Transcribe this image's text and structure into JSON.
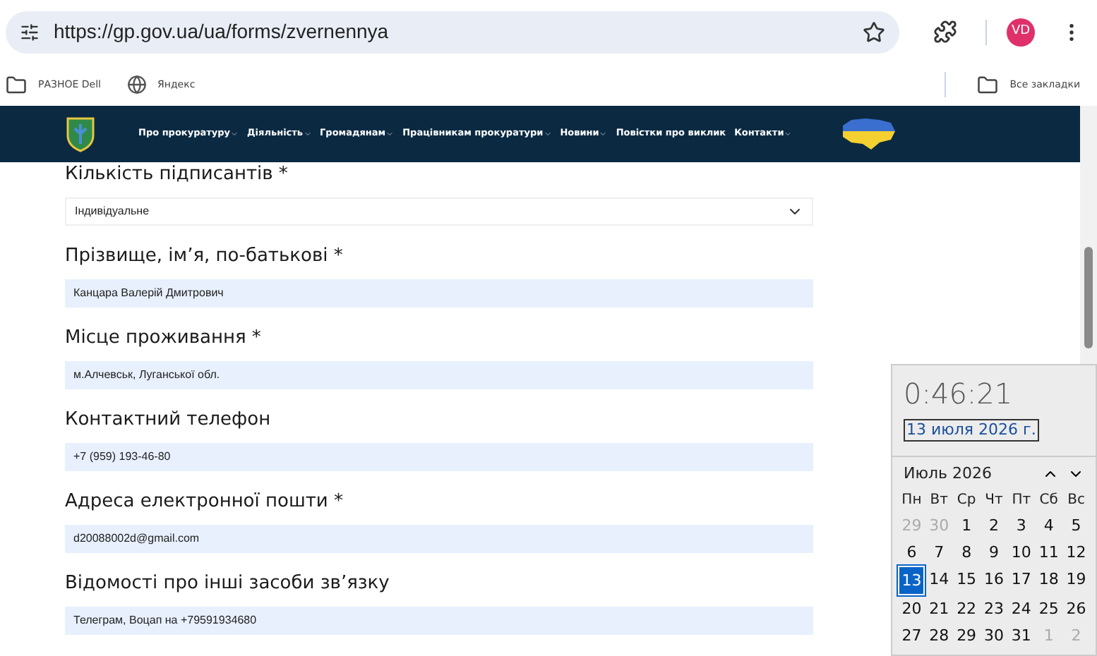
{
  "browser": {
    "url": "https://gp.gov.ua/ua/forms/zvernennya",
    "avatar": "VD",
    "bookmarks": [
      {
        "label": "РАЗНОЕ Dell",
        "kind": "folder"
      },
      {
        "label": "Яндекс",
        "kind": "site"
      }
    ],
    "all_bookmarks": "Все закладки"
  },
  "nav": {
    "items": [
      {
        "label": "Про прокуратуру",
        "dropdown": true
      },
      {
        "label": "Діяльність",
        "dropdown": true
      },
      {
        "label": "Громадянам",
        "dropdown": true
      },
      {
        "label": "Працівникам прокуратури",
        "dropdown": true
      },
      {
        "label": "Новини",
        "dropdown": true
      },
      {
        "label": "Повістки про виклик",
        "dropdown": false
      },
      {
        "label": "Контакти",
        "dropdown": true
      }
    ]
  },
  "form": {
    "fields": [
      {
        "label": "Кількість підписантів *",
        "kind": "select",
        "value": "Індивідуальне"
      },
      {
        "label": "Прізвище, ім’я, по-батькові *",
        "kind": "input",
        "value": "Канцара Валерій Дмитрович"
      },
      {
        "label": "Місце проживання *",
        "kind": "input",
        "value": "м.Алчевськ, Луганської обл."
      },
      {
        "label": "Контактний телефон",
        "kind": "input",
        "value": "+7 (959) 193-46-80"
      },
      {
        "label": "Адреса електронної пошти *",
        "kind": "input",
        "value": "d20088002d@gmail.com"
      },
      {
        "label": "Відомості про інші засоби зв’язку",
        "kind": "input",
        "value": "Телеграм, Воцап на +79591934680"
      }
    ]
  },
  "clock": {
    "time": "0:46:21",
    "date": "13 июля 2026 г.",
    "month": "Июль 2026",
    "weekdays": [
      "Пн",
      "Вт",
      "Ср",
      "Чт",
      "Пт",
      "Сб",
      "Вс"
    ],
    "days": [
      {
        "label": "29",
        "current_month": false,
        "selected": false
      },
      {
        "label": "30",
        "current_month": false,
        "selected": false
      },
      {
        "label": "1",
        "current_month": true,
        "selected": false
      },
      {
        "label": "2",
        "current_month": true,
        "selected": false
      },
      {
        "label": "3",
        "current_month": true,
        "selected": false
      },
      {
        "label": "4",
        "current_month": true,
        "selected": false
      },
      {
        "label": "5",
        "current_month": true,
        "selected": false
      },
      {
        "label": "6",
        "current_month": true,
        "selected": false
      },
      {
        "label": "7",
        "current_month": true,
        "selected": false
      },
      {
        "label": "8",
        "current_month": true,
        "selected": false
      },
      {
        "label": "9",
        "current_month": true,
        "selected": false
      },
      {
        "label": "10",
        "current_month": true,
        "selected": false
      },
      {
        "label": "11",
        "current_month": true,
        "selected": false
      },
      {
        "label": "12",
        "current_month": true,
        "selected": false
      },
      {
        "label": "13",
        "current_month": true,
        "selected": true
      },
      {
        "label": "14",
        "current_month": true,
        "selected": false
      },
      {
        "label": "15",
        "current_month": true,
        "selected": false
      },
      {
        "label": "16",
        "current_month": true,
        "selected": false
      },
      {
        "label": "17",
        "current_month": true,
        "selected": false
      },
      {
        "label": "18",
        "current_month": true,
        "selected": false
      },
      {
        "label": "19",
        "current_month": true,
        "selected": false
      },
      {
        "label": "20",
        "current_month": true,
        "selected": false
      },
      {
        "label": "21",
        "current_month": true,
        "selected": false
      },
      {
        "label": "22",
        "current_month": true,
        "selected": false
      },
      {
        "label": "23",
        "current_month": true,
        "selected": false
      },
      {
        "label": "24",
        "current_month": true,
        "selected": false
      },
      {
        "label": "25",
        "current_month": true,
        "selected": false
      },
      {
        "label": "26",
        "current_month": true,
        "selected": false
      },
      {
        "label": "27",
        "current_month": true,
        "selected": false
      },
      {
        "label": "28",
        "current_month": true,
        "selected": false
      },
      {
        "label": "29",
        "current_month": true,
        "selected": false
      },
      {
        "label": "30",
        "current_month": true,
        "selected": false
      },
      {
        "label": "31",
        "current_month": true,
        "selected": false
      },
      {
        "label": "1",
        "current_month": false,
        "selected": false
      },
      {
        "label": "2",
        "current_month": false,
        "selected": false
      }
    ]
  }
}
